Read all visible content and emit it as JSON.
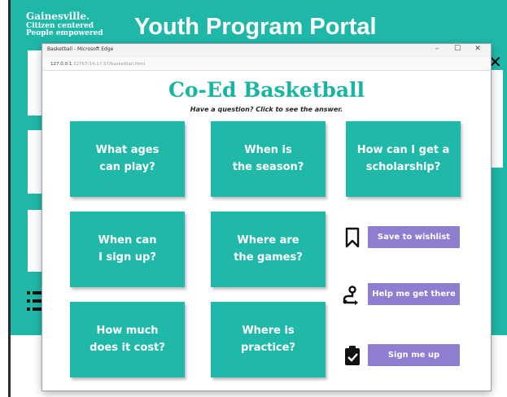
{
  "portal": {
    "brand_line1": "Gainesville.",
    "brand_line2": "Citizen centered",
    "brand_line3": "People empowered",
    "title": "Youth Program Portal"
  },
  "window": {
    "title": "Basketball - Microsoft Edge",
    "url_host": "127.0.0.1",
    "url_rest": ":32767/14.17.57/basketball.html",
    "controls": {
      "minimize": "–",
      "maximize": "☐",
      "close": "✕"
    }
  },
  "page": {
    "title": "Co-Ed Basketball",
    "subtitle": "Have a question? Click to see the answer."
  },
  "tiles": [
    {
      "label": "What ages\ncan play?"
    },
    {
      "label": "When is\nthe season?"
    },
    {
      "label": "How can I get a\nscholarship?"
    },
    {
      "label": "When can\nI sign up?"
    },
    {
      "label": "Where are\nthe games?"
    },
    {
      "label": "How much\ndoes it cost?"
    },
    {
      "label": "Where is\npractice?"
    }
  ],
  "actions": [
    {
      "label": "Save to wishlist",
      "icon": "bookmark-icon"
    },
    {
      "label": "Help me get there",
      "icon": "route-icon"
    },
    {
      "label": "Sign me up",
      "icon": "clipboard-check-icon"
    }
  ],
  "colors": {
    "teal": "#1fb8a8",
    "tile": "#20b9a9",
    "title_teal": "#18b4a4",
    "action_purple": "#8e7dd1"
  }
}
